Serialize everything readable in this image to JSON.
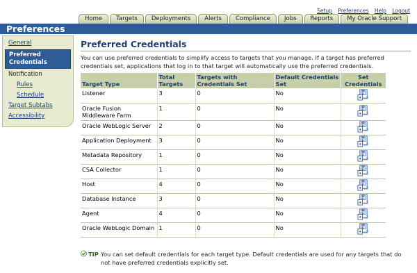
{
  "top_links": [
    "Setup",
    "Preferences",
    "Help",
    "Logout"
  ],
  "tabs": [
    "Home",
    "Targets",
    "Deployments",
    "Alerts",
    "Compliance",
    "Jobs",
    "Reports",
    "My Oracle Support"
  ],
  "app_title": "Preferences",
  "sidebar": {
    "general": "General",
    "preferred_credentials": "Preferred Credentials",
    "notification": "Notification",
    "rules": "Rules",
    "schedule": "Schedule",
    "target_subtabs": "Target Subtabs",
    "accessibility": "Accessibility"
  },
  "main": {
    "title": "Preferred Credentials",
    "intro": "You can use preferred credentials to simplify access to targets that you manage. If a target has preferred credentials set, applications that log in to that target will automatically use the preferred credentials."
  },
  "table": {
    "headers": [
      "Target Type",
      "Total Targets",
      "Targets with Credentials Set",
      "Default Credentials Set",
      "Set Credentials"
    ],
    "rows": [
      {
        "type": "Listener",
        "total": "3",
        "with_creds": "0",
        "default": "No"
      },
      {
        "type": "Oracle Fusion Middleware Farm",
        "total": "1",
        "with_creds": "0",
        "default": "No"
      },
      {
        "type": "Oracle WebLogic Server",
        "total": "2",
        "with_creds": "0",
        "default": "No"
      },
      {
        "type": "Application Deployment",
        "total": "3",
        "with_creds": "0",
        "default": "No"
      },
      {
        "type": "Metadata Repository",
        "total": "1",
        "with_creds": "0",
        "default": "No"
      },
      {
        "type": "CSA Collector",
        "total": "1",
        "with_creds": "0",
        "default": "No"
      },
      {
        "type": "Host",
        "total": "4",
        "with_creds": "0",
        "default": "No"
      },
      {
        "type": "Database Instance",
        "total": "3",
        "with_creds": "0",
        "default": "No"
      },
      {
        "type": "Agent",
        "total": "4",
        "with_creds": "0",
        "default": "No"
      },
      {
        "type": "Oracle WebLogic Domain",
        "total": "1",
        "with_creds": "0",
        "default": "No"
      }
    ],
    "set_icon": "set-credentials-icon"
  },
  "tip": {
    "label": "TIP",
    "text": "You can set default credentials for each target type. Default credentials are used for any targets that do not have preferred credentials explicitly set."
  },
  "colors": {
    "header_blue": "#2e5c96",
    "tab_olive": "#c7cea3",
    "sidebar_bg": "#e7ebcf",
    "table_header": "#c6cfa9",
    "title_text": "#1f3f6e"
  }
}
